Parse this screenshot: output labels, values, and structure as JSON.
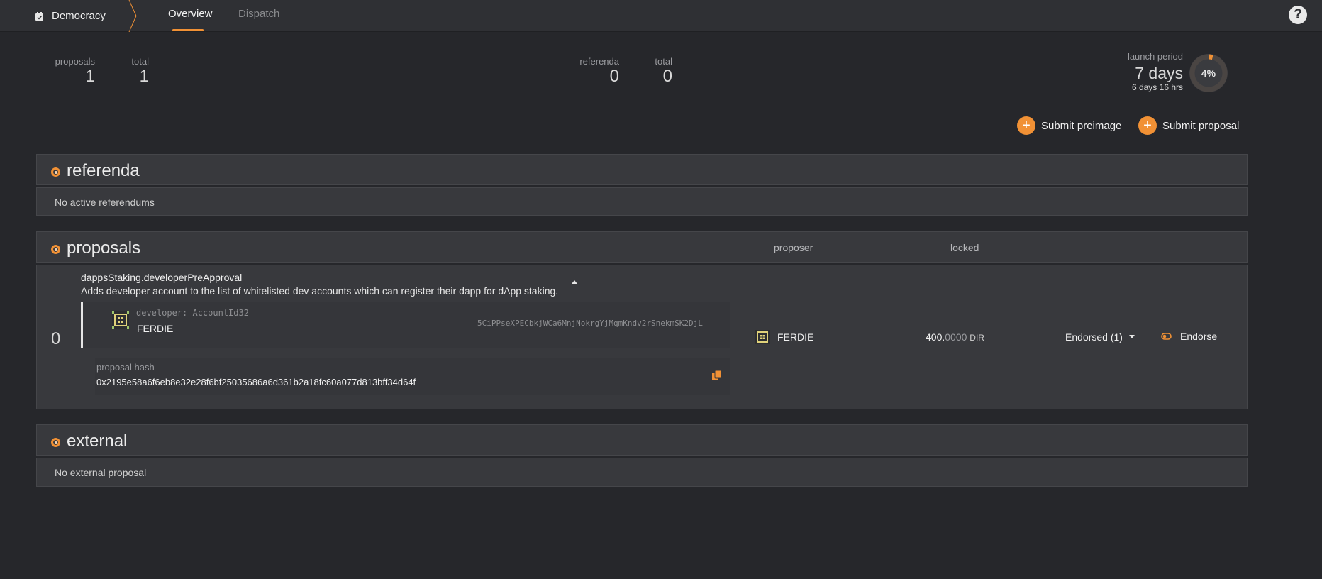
{
  "app": {
    "section": "Democracy",
    "section_icon": "calendar-icon"
  },
  "tabs": [
    {
      "label": "Overview",
      "active": true
    },
    {
      "label": "Dispatch",
      "active": false
    }
  ],
  "help": {
    "label": "?"
  },
  "summary": {
    "proposals_label": "proposals",
    "proposals": "1",
    "proposals_total_label": "total",
    "proposals_total": "1",
    "referenda_label": "referenda",
    "referenda": "0",
    "referenda_total_label": "total",
    "referenda_total": "0",
    "launch_label": "launch period",
    "launch_days": "7 days",
    "launch_remaining": "6 days 16 hrs",
    "launch_percent": "4%",
    "launch_fraction": 0.04
  },
  "actions": {
    "preimage": "Submit preimage",
    "proposal": "Submit proposal"
  },
  "referenda_section": {
    "title": "referenda",
    "empty": "No active referendums"
  },
  "proposals_section": {
    "title": "proposals",
    "col_proposer": "proposer",
    "col_locked": "locked",
    "item": {
      "index": "0",
      "call": "dappsStaking.developerPreApproval",
      "description": "Adds developer account to the list of whitelisted dev accounts which can register their dapp for dApp staking.",
      "param_label": "developer: AccountId32",
      "param_name": "FERDIE",
      "param_address": "5CiPPseXPECbkjWCa6MnjNokrgYjMqmKndv2rSnekmSK2DjL",
      "hash_label": "proposal hash",
      "hash": "0x2195e58a6f6eb8e32e28f6bf25035686a6d361b2a18fc60a077d813bff34d64f",
      "proposer": "FERDIE",
      "locked_int": "400.",
      "locked_dec": "0000",
      "locked_unit": "DIR",
      "endorsed": "Endorsed (1)",
      "endorse": "Endorse"
    }
  },
  "external_section": {
    "title": "external",
    "empty": "No external proposal"
  },
  "colors": {
    "accent": "#f19135",
    "background": "#26272b",
    "panel": "#38393d"
  }
}
